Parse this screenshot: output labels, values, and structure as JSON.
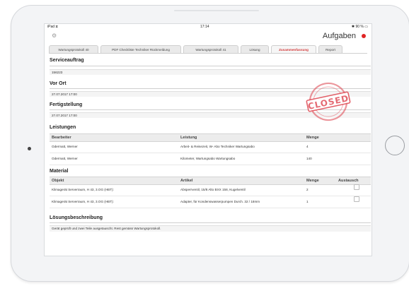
{
  "status_bar": {
    "device": "iPad ⧖",
    "time": "17:14",
    "battery": "✱ 90 % ▭"
  },
  "navbar": {
    "title": "Aufgaben",
    "gear_icon": "gear-icon",
    "record_icon": "record-icon"
  },
  "tabs": [
    {
      "label": "Wartungsprotokoll 40"
    },
    {
      "label": "PDF Checkliste Techniker Rückmeldung"
    },
    {
      "label": "Wartungsprotokoll 41"
    },
    {
      "label": "Lösung"
    },
    {
      "label": "Zusammenfassung",
      "active": true
    },
    {
      "label": "Report"
    }
  ],
  "sections": {
    "serviceauftrag": {
      "title": "Serviceauftrag",
      "value": "156223"
    },
    "vor_ort": {
      "title": "Vor Ort",
      "value": "27.07.2017 17:00"
    },
    "fertigstellung": {
      "title": "Fertigstellung",
      "value": "27.07.2017 17:00"
    },
    "leistungen": {
      "title": "Leistungen",
      "headers": {
        "bearbeiter": "Bearbeiter",
        "leistung": "Leistung",
        "menge": "Menge"
      },
      "rows": [
        {
          "bearbeiter": "Odermatt, Werner",
          "leistung": "Arbeit- & Reisezeit, W- Abo Techniker Wartungsabo",
          "menge": "4"
        },
        {
          "bearbeiter": "Odermatt, Werner",
          "leistung": "Kilometer, Wartungsabo Wartungsabo",
          "menge": "140"
        }
      ]
    },
    "material": {
      "title": "Material",
      "headers": {
        "objekt": "Objekt",
        "artikel": "Artikel",
        "menge": "Menge",
        "austausch": "Austausch"
      },
      "rows": [
        {
          "objekt": "Klimagerät Serverraum, H 43, 3.OG (HBT):",
          "artikel": "Absperrventil, 15/8 Alto BXX 158, Kugelventil",
          "menge": "2",
          "austausch": false
        },
        {
          "objekt": "Klimagerät Serverraum, H 43, 3.OG (HBT):",
          "artikel": "Adapter, für Kondenswasserpumpen Durch. 32 / 18mm",
          "menge": "1",
          "austausch": false
        }
      ]
    },
    "loesung": {
      "title": "Lösungsbeschreibung",
      "value": "Gerät geprüft und zwei Teile ausgetauscht. Rest gemäss Wartungsprotokoll."
    }
  },
  "stamp": {
    "text": "CLOSED",
    "color": "#e0505a"
  }
}
